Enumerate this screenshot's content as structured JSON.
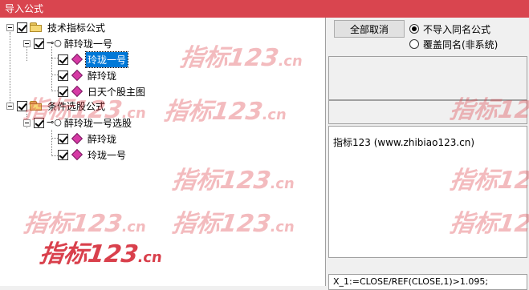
{
  "window": {
    "title": "导入公式"
  },
  "tree": {
    "nodes": [
      {
        "label": "技术指标公式",
        "icon": "folder-icon",
        "checked": true
      },
      {
        "label": "醉玲珑一号",
        "icon": "key-icon",
        "checked": true
      },
      {
        "label": "玲珑一号",
        "icon": "diamond-icon",
        "checked": true,
        "selected": true
      },
      {
        "label": "醉玲珑",
        "icon": "diamond-icon",
        "checked": true
      },
      {
        "label": "日天个股主图",
        "icon": "diamond-icon",
        "checked": true
      },
      {
        "label": "条件选股公式",
        "icon": "folder-icon",
        "checked": true
      },
      {
        "label": "醉玲珑一号选股",
        "icon": "key-icon",
        "checked": true
      },
      {
        "label": "醉玲珑",
        "icon": "diamond-icon",
        "checked": true
      },
      {
        "label": "玲珑一号",
        "icon": "diamond-icon",
        "checked": true
      }
    ]
  },
  "controls": {
    "cancel_all_label": "全部取消",
    "radio_no_import_label": "不导入同名公式",
    "radio_overwrite_label": "覆盖同名(非系统)",
    "radio_selected": "no_import"
  },
  "info": {
    "text": "指标123  (www.zhibiao123.cn)"
  },
  "code": {
    "text": "X_1:=CLOSE/REF(CLOSE,1)>1.095;"
  },
  "watermark": {
    "main": "指标123",
    "suffix": ".cn"
  },
  "colors": {
    "titlebar": "#d9454f",
    "selection": "#0078d7",
    "diamond": "#d63aa5",
    "watermark": "#d21e2d"
  }
}
